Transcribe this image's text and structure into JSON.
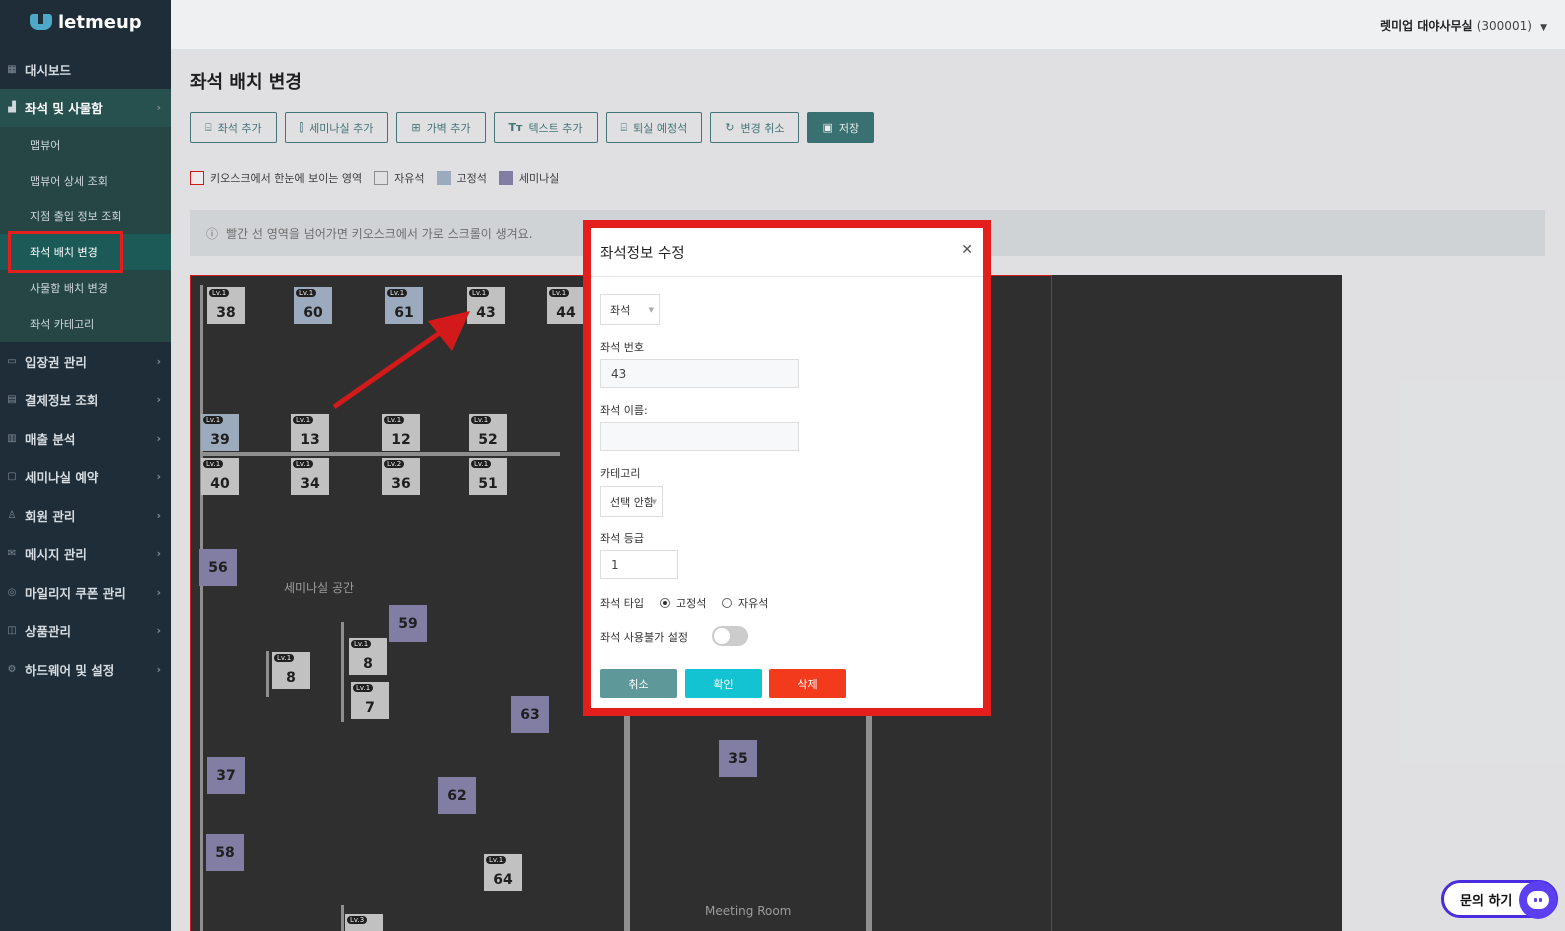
{
  "brand": {
    "name": "letmeup"
  },
  "account": {
    "name": "렛미업 대야사무실",
    "code": "(300001)"
  },
  "sidebar": {
    "items": [
      {
        "label": "대시보드",
        "icon": "dashboard-icon"
      },
      {
        "label": "좌석 및 사물함",
        "icon": "seat-icon"
      },
      {
        "label": "입장권 관리",
        "icon": "ticket-icon"
      },
      {
        "label": "결제정보 조회",
        "icon": "card-icon"
      },
      {
        "label": "매출 분석",
        "icon": "chart-icon"
      },
      {
        "label": "세미나실 예약",
        "icon": "calendar-icon"
      },
      {
        "label": "회원 관리",
        "icon": "users-icon"
      },
      {
        "label": "메시지 관리",
        "icon": "mail-icon"
      },
      {
        "label": "마일리지 쿠폰 관리",
        "icon": "coupon-icon"
      },
      {
        "label": "상품관리",
        "icon": "product-icon"
      },
      {
        "label": "하드웨어 및 설정",
        "icon": "gear-icon"
      }
    ],
    "sub_items": [
      "맵뷰어",
      "맵뷰어 상세 조회",
      "지점 출입 정보 조회",
      "좌석 배치 변경",
      "사물함 배치 변경",
      "좌석 카테고리"
    ]
  },
  "page": {
    "title": "좌석 배치 변경"
  },
  "toolbar": {
    "add_seat": "좌석 추가",
    "add_seminar": "세미나실 추가",
    "add_wall": "가벽 추가",
    "add_text": "텍스트 추가",
    "leaving_seat": "퇴실 예정석",
    "undo": "변경 취소",
    "save": "저장"
  },
  "legend": {
    "kiosk": "키오스크에서 한눈에 보이는 영역",
    "free": "자유석",
    "fixed": "고정석",
    "seminar": "세미나실"
  },
  "info": {
    "text": "빨간 선 영역을 넘어가면 키오스크에서 가로 스크롤이 생겨요."
  },
  "map": {
    "seminar_space_label": "세미나실 공간",
    "meeting_room_label": "Meeting Room",
    "seats": {
      "s38": {
        "num": "38",
        "lv": "Lv.1"
      },
      "s60": {
        "num": "60",
        "lv": "Lv.1"
      },
      "s61": {
        "num": "61",
        "lv": "Lv.1"
      },
      "s43": {
        "num": "43",
        "lv": "Lv.1"
      },
      "s44": {
        "num": "44",
        "lv": "Lv.1"
      },
      "s39": {
        "num": "39",
        "lv": "Lv.1"
      },
      "s13": {
        "num": "13",
        "lv": "Lv.1"
      },
      "s12": {
        "num": "12",
        "lv": "Lv.1"
      },
      "s52": {
        "num": "52",
        "lv": "Lv.1"
      },
      "s40": {
        "num": "40",
        "lv": "Lv.1"
      },
      "s34": {
        "num": "34",
        "lv": "Lv.1"
      },
      "s36": {
        "num": "36",
        "lv": "Lv.2"
      },
      "s51": {
        "num": "51",
        "lv": "Lv.1"
      },
      "s8a": {
        "num": "8",
        "lv": "Lv.1"
      },
      "s8b": {
        "num": "8",
        "lv": "Lv.1"
      },
      "s7": {
        "num": "7",
        "lv": "Lv.1"
      },
      "s64": {
        "num": "64",
        "lv": "Lv.1"
      },
      "s_bottom": {
        "num": "",
        "lv": "Lv.3"
      },
      "r56": {
        "num": "56"
      },
      "r59": {
        "num": "59"
      },
      "r63": {
        "num": "63"
      },
      "r37": {
        "num": "37"
      },
      "r62": {
        "num": "62"
      },
      "r58": {
        "num": "58"
      },
      "r35": {
        "num": "35"
      }
    }
  },
  "modal": {
    "title": "좌석정보 수정",
    "type_select": "좌석",
    "seat_number_label": "좌석 번호",
    "seat_number_value": "43",
    "seat_name_label": "좌석 이름:",
    "seat_name_value": "",
    "category_label": "카테고리",
    "category_value": "선택 안함",
    "grade_label": "좌석 등급",
    "grade_value": "1",
    "seat_type_label": "좌석 타입",
    "seat_type_fixed": "고정석",
    "seat_type_free": "자유석",
    "disable_label": "좌석 사용불가 설정",
    "cancel": "취소",
    "confirm": "확인",
    "delete": "삭제"
  },
  "chat": {
    "label": "문의 하기"
  },
  "colors": {
    "accent": "#3e7a7c",
    "highlight": "#e41d1d",
    "confirm": "#14c3d1",
    "delete": "#f23b1c"
  }
}
